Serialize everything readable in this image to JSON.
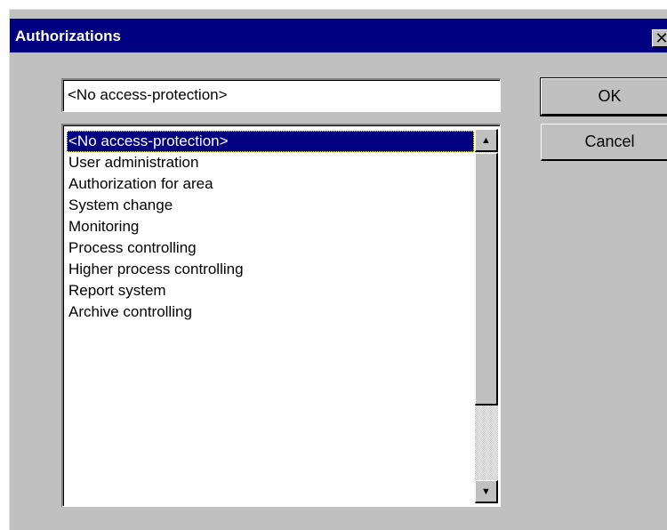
{
  "window": {
    "title": "Authorizations",
    "close_glyph": "✕"
  },
  "input": {
    "value": "<No access-protection>"
  },
  "list": {
    "items": [
      {
        "label": "<No access-protection>",
        "selected": true
      },
      {
        "label": "User administration",
        "selected": false
      },
      {
        "label": "Authorization for area",
        "selected": false
      },
      {
        "label": "System change",
        "selected": false
      },
      {
        "label": "Monitoring",
        "selected": false
      },
      {
        "label": "Process controlling",
        "selected": false
      },
      {
        "label": "Higher process controlling",
        "selected": false
      },
      {
        "label": "Report system",
        "selected": false
      },
      {
        "label": "Archive controlling",
        "selected": false
      }
    ],
    "scroll_up_glyph": "▲",
    "scroll_down_glyph": "▼"
  },
  "buttons": {
    "ok_label": "OK",
    "cancel_label": "Cancel"
  },
  "colors": {
    "titlebar": "#000080",
    "face": "#c0c0c0",
    "selection": "#000080"
  }
}
